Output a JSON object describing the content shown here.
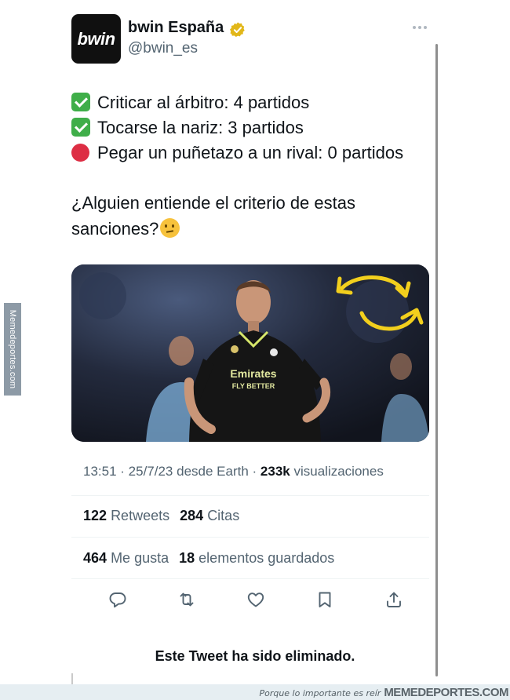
{
  "profile": {
    "avatar_text": "bwin",
    "display_name": "bwin España",
    "handle": "@bwin_es",
    "verified_icon": "verified-badge-gold",
    "more_icon": "more-horizontal-icon"
  },
  "tweet": {
    "lines": [
      "Criticar al árbitro: 4 partidos",
      "Tocarse la nariz: 3 partidos",
      "Pegar un puñetazo a un rival: 0 partidos"
    ],
    "question_line1": "¿Alguien entiende el criterio de estas",
    "question_line2": "sanciones?",
    "emojis": [
      "white-check-mark",
      "white-check-mark",
      "red-circle",
      "thinking-face"
    ],
    "image": {
      "jersey_text1": "Emirates",
      "jersey_text2": "FLY BETTER"
    }
  },
  "meta": {
    "time": "13:51",
    "date": "25/7/23",
    "source": "desde Earth",
    "views_count": "233k",
    "views_label": "visualizaciones"
  },
  "stats": {
    "retweets_count": "122",
    "retweets_label": "Retweets",
    "quotes_count": "284",
    "quotes_label": "Citas",
    "likes_count": "464",
    "likes_label": "Me gusta",
    "bookmarks_count": "18",
    "bookmarks_label": "elementos guardados"
  },
  "actions": [
    "reply-icon",
    "retweet-icon",
    "like-icon",
    "bookmark-icon",
    "share-icon"
  ],
  "deleted_notice": "Este Tweet ha sido eliminado.",
  "watermark": {
    "side": "Memedeportes.com",
    "footer_tagline": "Porque lo importante es reír",
    "footer_brand": "MEMEDEPORTES.COM"
  },
  "colors": {
    "text_primary": "#0f1419",
    "text_secondary": "#536471",
    "divider": "#eff3f4",
    "verified_gold": "#e2b719"
  }
}
